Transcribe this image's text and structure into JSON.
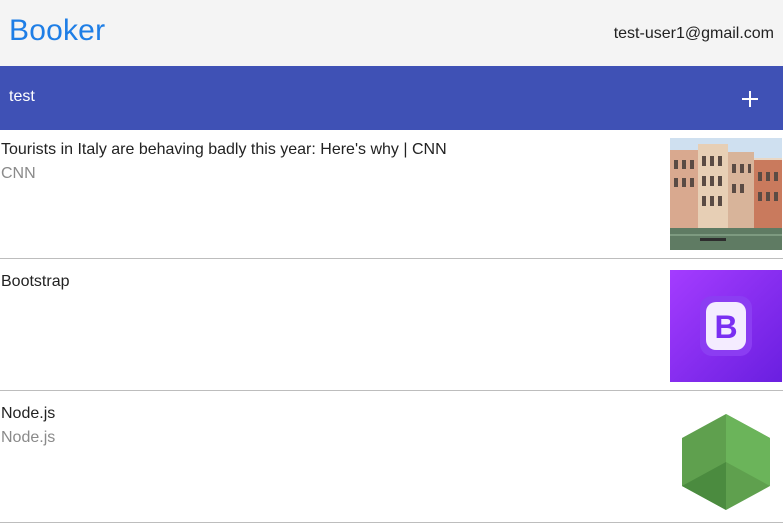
{
  "header": {
    "brand": "Booker",
    "user_email": "test-user1@gmail.com"
  },
  "list": {
    "title": "test",
    "add_icon": "plus-icon",
    "items": [
      {
        "title": "Tourists in Italy are behaving badly this year: Here's why | CNN",
        "source": "CNN",
        "thumbnail": "venice-canal-photo"
      },
      {
        "title": "Bootstrap",
        "source": "",
        "thumbnail": "bootstrap-logo"
      },
      {
        "title": "Node.js",
        "source": "Node.js",
        "thumbnail": "nodejs-logo"
      }
    ]
  },
  "colors": {
    "brand": "#1e7ee6",
    "list_header": "#3f51b5",
    "bootstrap_purple": "#7b2ff7",
    "node_green": "#5fa04e"
  }
}
